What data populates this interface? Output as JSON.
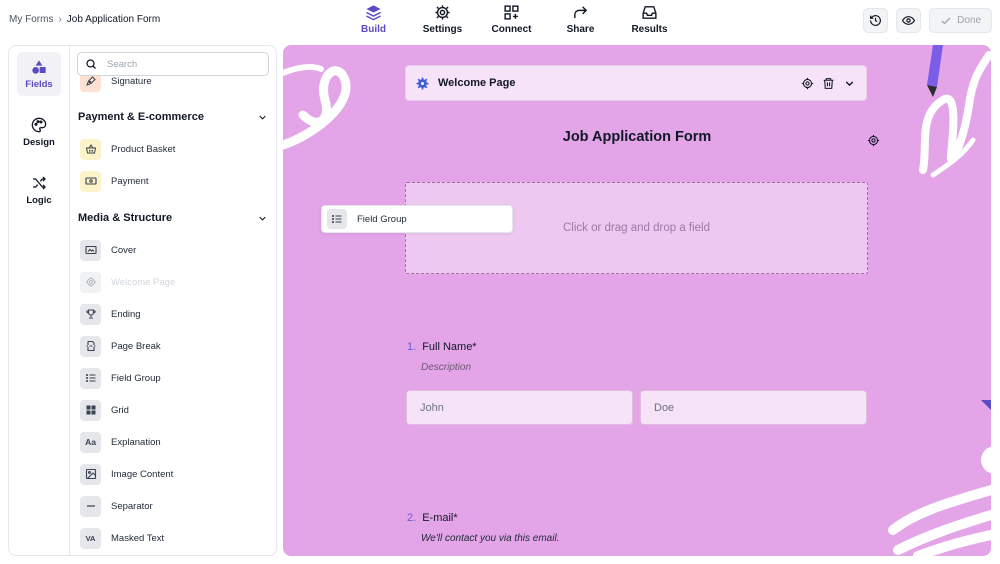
{
  "breadcrumb": {
    "parent": "My Forms",
    "separator": "›",
    "current": "Job Application Form"
  },
  "top_tabs": [
    {
      "label": "Build",
      "icon": "layers-icon",
      "active": true
    },
    {
      "label": "Settings",
      "icon": "gear-icon",
      "active": false
    },
    {
      "label": "Connect",
      "icon": "connect-grid-icon",
      "active": false
    },
    {
      "label": "Share",
      "icon": "share-arrow-icon",
      "active": false
    },
    {
      "label": "Results",
      "icon": "inbox-icon",
      "active": false
    }
  ],
  "top_actions": {
    "history_icon": "history-icon",
    "preview_icon": "eye-icon",
    "done_label": "Done",
    "done_icon": "check-icon"
  },
  "rail": [
    {
      "label": "Fields",
      "icon": "shapes-icon",
      "active": true
    },
    {
      "label": "Design",
      "icon": "palette-icon",
      "active": false
    },
    {
      "label": "Logic",
      "icon": "shuffle-icon",
      "active": false
    }
  ],
  "search": {
    "placeholder": "Search",
    "value": ""
  },
  "fields_panel": {
    "top_item": {
      "label": "Signature",
      "icon": "pen-nib-icon"
    },
    "sections": [
      {
        "title": "Payment & E-commerce",
        "items": [
          {
            "label": "Product Basket",
            "icon": "basket-icon"
          },
          {
            "label": "Payment",
            "icon": "banknote-icon"
          }
        ]
      },
      {
        "title": "Media & Structure",
        "items": [
          {
            "label": "Cover",
            "icon": "cover-icon"
          },
          {
            "label": "Welcome Page",
            "icon": "gear-icon",
            "disabled": true
          },
          {
            "label": "Ending",
            "icon": "trophy-icon"
          },
          {
            "label": "Page Break",
            "icon": "page-break-icon"
          },
          {
            "label": "Field Group",
            "icon": "list-icon"
          },
          {
            "label": "Grid",
            "icon": "grid-icon"
          },
          {
            "label": "Explanation",
            "icon": "text-aa-icon",
            "icon_text": "Aa"
          },
          {
            "label": "Image Content",
            "icon": "image-icon"
          },
          {
            "label": "Separator",
            "icon": "separator-icon"
          },
          {
            "label": "Masked Text",
            "icon": "masked-text-icon",
            "icon_text": "VA"
          }
        ]
      }
    ]
  },
  "canvas": {
    "welcome_bar": {
      "title": "Welcome Page"
    },
    "form_title": "Job Application Form",
    "drop_zone": "Click or drag and drop a field",
    "drag_ghost": {
      "label": "Field Group",
      "icon": "list-icon"
    },
    "questions": [
      {
        "number": "1.",
        "label": "Full Name*",
        "description": "Description",
        "inputs": [
          {
            "placeholder": "John"
          },
          {
            "placeholder": "Doe"
          }
        ]
      },
      {
        "number": "2.",
        "label": "E-mail*",
        "description": "We'll contact you via this email."
      }
    ]
  },
  "colors": {
    "accent": "#5b4bc4",
    "canvas_bg": "#e3a4e8",
    "welcome_bar_bg": "#f7e3f8",
    "drop_zone_bg": "#edc8f0"
  }
}
